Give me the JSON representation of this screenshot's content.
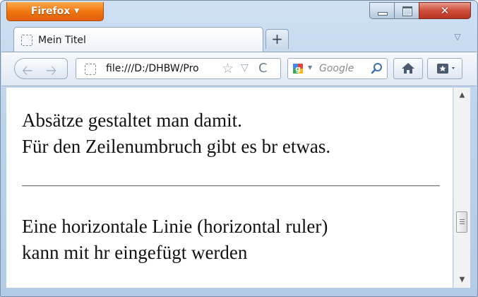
{
  "browser": {
    "menu_button_label": "Firefox",
    "menu_button_arrow": "▼",
    "window_controls": [
      "minimize",
      "maximize",
      "close"
    ],
    "close_glyph": "✕"
  },
  "tabs": [
    {
      "title": "Mein Titel",
      "active": true
    }
  ],
  "new_tab_label": "+",
  "tabs_list_glyph": "▽",
  "navigation": {
    "back_glyph": "🡠",
    "forward_glyph": "🡢",
    "url": "file:///D:/DHBW/Pro",
    "star_glyph": "☆",
    "dropdown_glyph": "▽",
    "reload_glyph": "C",
    "search_engine": "Google",
    "search_placeholder": "Google"
  },
  "page": {
    "paragraph1_line1": "Absätze gestaltet man damit.",
    "paragraph1_line2": "Für den Zeilenumbruch gibt es br etwas.",
    "paragraph2_line1": "Eine horizontale Linie (horizontal ruler)",
    "paragraph2_line2": "kann mit hr eingefügt werden"
  },
  "scrollbar": {
    "up_glyph": "▲",
    "down_glyph": "▼"
  },
  "colors": {
    "firefox_orange": "#f1770f",
    "close_red": "#cf4d3a",
    "chrome_blue": "#bcd3ec"
  }
}
